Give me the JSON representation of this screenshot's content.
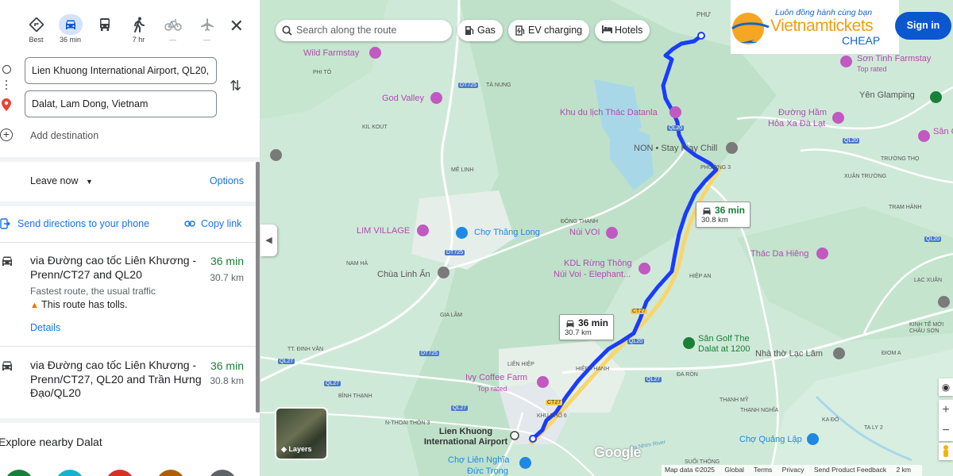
{
  "modes": [
    {
      "label": "Best",
      "icon": "directions-icon"
    },
    {
      "label": "36 min",
      "icon": "car-icon"
    },
    {
      "label": "",
      "icon": "bus-icon"
    },
    {
      "label": "7 hr",
      "icon": "walk-icon"
    },
    {
      "label": "—",
      "icon": "bicycle-icon"
    },
    {
      "label": "—",
      "icon": "flight-icon"
    }
  ],
  "origin": "Lien Khuong International Airport, QL20,",
  "destination": "Dalat, Lam Dong, Vietnam",
  "add_destination": "Add destination",
  "leave_now": "Leave now",
  "options": "Options",
  "send_directions": "Send directions to your phone",
  "copy_link": "Copy link",
  "routes": [
    {
      "title": "via Đường cao tốc Liên Khương - Prenn/CT27 and QL20",
      "time": "36 min",
      "distance": "30.7 km",
      "note": "Fastest route, the usual traffic",
      "toll": "This route has tolls.",
      "details": "Details"
    },
    {
      "title": "via Đường cao tốc Liên Khương - Prenn/CT27, QL20 and Trần Hưng Đạo/QL20",
      "time": "36 min",
      "distance": "30.8 km"
    }
  ],
  "explore": "Explore nearby Dalat",
  "map": {
    "search_placeholder": "Search along the route",
    "chips": [
      "Gas",
      "EV charging",
      "Hotels"
    ],
    "sign_in": "Sign in",
    "ad_tagline": "Luôn đồng hành cùng bạn",
    "ad_brand": "Vietnamtickets",
    "ad_cheap": "CHEAP",
    "layers": "Layers",
    "google": "Google",
    "footer": [
      "Map data ©2025",
      "Global",
      "Terms",
      "Privacy",
      "Send Product Feedback",
      "2 km"
    ],
    "route_box_1": {
      "time": "36 min",
      "distance": "30.8 km"
    },
    "route_box_2": {
      "time": "36 min",
      "distance": "30.7 km"
    },
    "airport": "Lien Khuong International Airport",
    "labels": {
      "phuoc": "PHƯ",
      "wild_farmstay": "Wild Farmstay",
      "phi_to": "PHI TÔ",
      "ta_nung": "TÀ NUNG",
      "god_valley": "God Valley",
      "thac_datanla": "Khu du lịch Thác Datanla",
      "kil_kout": "KIL KOUT",
      "non_stay": "NON • Stay Play Chill",
      "me_linh": "MÊ LINH",
      "phuong3": "PHƯỜNG 3",
      "dong_thanh": "ĐÔNG THANH",
      "lim_village": "LIM VILLAGE",
      "cho_thang_long": "Chợ Thăng Long",
      "nui_voi": "Núi VOI",
      "kdl_rung_thong": "KDL Rừng Thông",
      "nui_voi_elephant": "Núi Voi - Elephant...",
      "nam_ha": "NAM HÀ",
      "chua_linh_an": "Chùa Linh Ẩn",
      "hiep_an": "HIỆP AN",
      "gia_lam": "GIA LÂM",
      "tt_dinh_van": "TT. ĐINH VĂN",
      "lien_hiep": "LIÊN HIỆP",
      "hiep_thanh": "HIỆP THẠNH",
      "ivy_coffee": "Ivy Coffee Farm",
      "top_rated": "Top rated",
      "binh_thanh": "BÌNH THẠNH",
      "khu_pho_6": "KHU PHỐ 6",
      "ninh_thuan": "N-THOẠI THÔN 3",
      "cho_lien_nghia": "Chợ Liên Nghĩa",
      "duc_trong": "Đức Trọng",
      "da_ron": "ĐA RÒN",
      "san_golf": "Sân Golf The Dalat at 1200",
      "nha_tho_lac_lam": "Nhà thờ Lạc Lâm",
      "thanh_my": "THẠNH MỸ",
      "thanh_nghia": "THẠNH NGHĨA",
      "cho_quang_lap": "Chợ Quảng Lập",
      "da_nhim": "Đa Nhim River",
      "suoi_thong": "SUỐI THÔNG",
      "ka_do": "KA ĐÔ",
      "ta_ly2": "TA LY 2",
      "dion_a": "ĐIOM A",
      "lac_xuan": "LẠC XUÂN",
      "kinh_te_moi": "KINH TẾ MỚI CHÂU SƠN",
      "thac_da_hieng": "Thác Da Hiêng",
      "son_tinh": "Sơn Tinh Farmstay",
      "yen_glamping": "Yên Glamping",
      "duong_ham": "Đường Hầm",
      "hoa_xa": "Hỏa Xa Đà Lạt",
      "truong_tho": "TRƯỜNG THỌ",
      "xuan_truong": "XUÂN TRƯỜNG",
      "tram_hanh": "TRẠM HÀNH",
      "lac_xuan_label": "LẠC XUÂN",
      "san_go": "Sân Gô -",
      "chau_son": "Cha"
    },
    "road_shields": [
      "DT725",
      "DT725",
      "DT725",
      "QL20",
      "QL20",
      "QL20",
      "QL20",
      "QL20",
      "QL27",
      "QL27",
      "QL27",
      "QL27",
      "CT27",
      "CT27",
      "QL20",
      "QL20"
    ]
  },
  "colors": {
    "route": "#1a3cff",
    "accent": "#1a73e8",
    "time_green": "#188038",
    "map_bg": "#cfe9d8",
    "poi_pink": "#c159c1"
  }
}
